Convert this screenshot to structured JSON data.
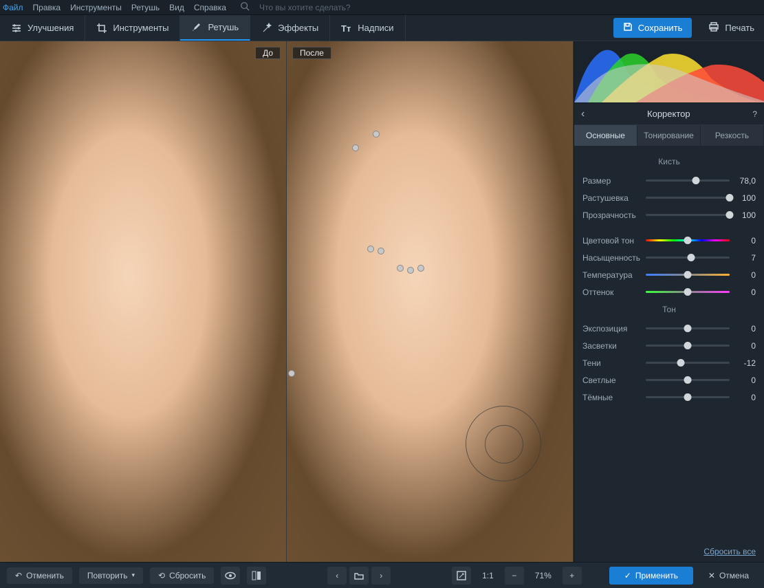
{
  "menubar": {
    "items": [
      "Файл",
      "Правка",
      "Инструменты",
      "Ретушь",
      "Вид",
      "Справка"
    ],
    "search_placeholder": "Что вы хотите сделать?"
  },
  "toolbar": {
    "tabs": [
      {
        "label": "Улучшения"
      },
      {
        "label": "Инструменты"
      },
      {
        "label": "Ретушь",
        "active": true
      },
      {
        "label": "Эффекты"
      },
      {
        "label": "Надписи"
      }
    ],
    "save_label": "Сохранить",
    "print_label": "Печать"
  },
  "preview": {
    "before_label": "До",
    "after_label": "После"
  },
  "panel": {
    "title": "Корректор",
    "subtabs": [
      "Основные",
      "Тонирование",
      "Резкость"
    ],
    "active_subtab": 0,
    "section_brush": "Кисть",
    "section_tone": "Тон",
    "reset_label": "Сбросить все",
    "sliders_brush": [
      {
        "label": "Размер",
        "value": "78,0",
        "pos": 60
      },
      {
        "label": "Растушевка",
        "value": "100",
        "pos": 100
      },
      {
        "label": "Прозрачность",
        "value": "100",
        "pos": 100
      }
    ],
    "sliders_color": [
      {
        "label": "Цветовой тон",
        "value": "0",
        "pos": 50,
        "track": "hue"
      },
      {
        "label": "Насыщенность",
        "value": "7",
        "pos": 54
      },
      {
        "label": "Температура",
        "value": "0",
        "pos": 50,
        "track": "temp"
      },
      {
        "label": "Оттенок",
        "value": "0",
        "pos": 50,
        "track": "tint"
      }
    ],
    "sliders_tone": [
      {
        "label": "Экспозиция",
        "value": "0",
        "pos": 50
      },
      {
        "label": "Засветки",
        "value": "0",
        "pos": 50
      },
      {
        "label": "Тени",
        "value": "-12",
        "pos": 42
      },
      {
        "label": "Светлые",
        "value": "0",
        "pos": 50
      },
      {
        "label": "Тёмные",
        "value": "0",
        "pos": 50
      }
    ]
  },
  "bottombar": {
    "undo": "Отменить",
    "redo": "Повторить",
    "reset": "Сбросить",
    "zoom_fit": "1:1",
    "zoom_value": "71%",
    "apply": "Применить",
    "cancel": "Отмена"
  }
}
